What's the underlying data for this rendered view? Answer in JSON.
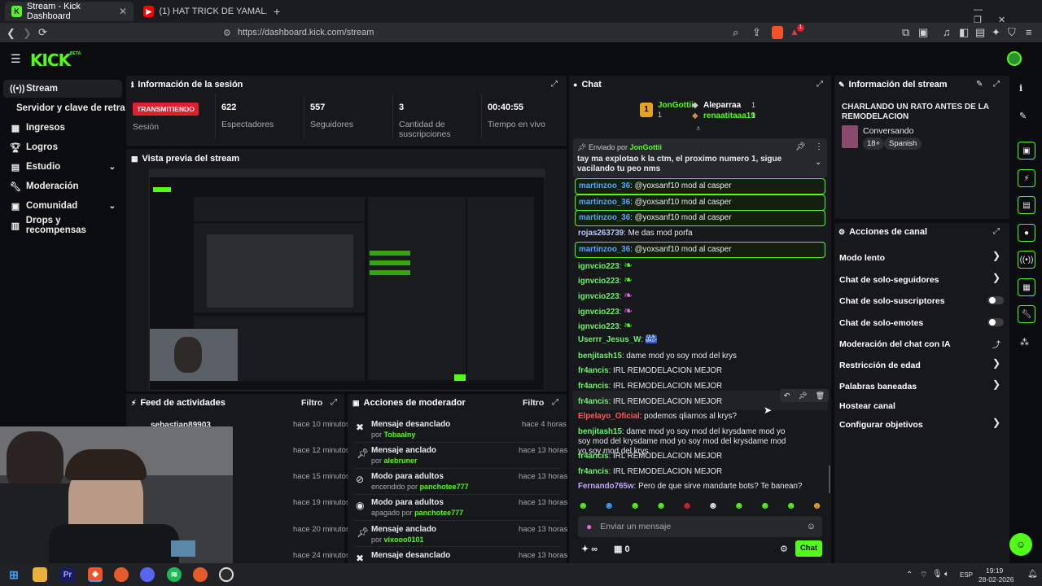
{
  "browser": {
    "tabs": [
      {
        "label": "Stream - Kick Dashboard",
        "icon": "kick-icon"
      },
      {
        "label": "(1) HAT TRICK DE YAMAL, GOLEADA",
        "icon": "youtube-icon"
      }
    ],
    "url": "https://dashboard.kick.com/stream",
    "new_tab": "+",
    "brave_badge": "1"
  },
  "header": {
    "logo": "KICK",
    "beta": "BETA"
  },
  "sidebar": {
    "items": [
      {
        "label": "Stream",
        "icon": "stream-icon"
      },
      {
        "label": "Servidor y clave de retransmisión"
      },
      {
        "label": "Ingresos",
        "icon": "income-icon"
      },
      {
        "label": "Logros",
        "icon": "trophy-icon"
      },
      {
        "label": "Estudio",
        "icon": "studio-icon"
      },
      {
        "label": "Moderación",
        "icon": "wrench-icon"
      },
      {
        "label": "Comunidad",
        "icon": "community-icon"
      },
      {
        "label": "Drops y recompensas",
        "icon": "drops-icon"
      }
    ]
  },
  "session": {
    "title": "Información de la sesión",
    "status": "TRANSMITIENDO",
    "status_label": "Sesión",
    "stats": [
      {
        "value": "622",
        "label": "Espectadores"
      },
      {
        "value": "557",
        "label": "Seguidores"
      },
      {
        "value": "3",
        "label": "Cantidad de suscripciones"
      },
      {
        "value": "00:40:55",
        "label": "Tiempo en vivo"
      }
    ]
  },
  "preview": {
    "title": "Vista previa del stream"
  },
  "activity": {
    "title": "Feed de actividades",
    "filter": "Filtro",
    "rows": [
      {
        "user": "sebastian89903",
        "time": "hace 10 minutos"
      },
      {
        "user": "",
        "time": "hace 12 minutos"
      },
      {
        "user": "",
        "time": "hace 15 minutos"
      },
      {
        "user": "",
        "time": "hace 19 minutos"
      },
      {
        "user": "",
        "time": "hace 20 minutos"
      },
      {
        "user": "",
        "time": "hace 24 minutos"
      }
    ]
  },
  "modactions": {
    "title": "Acciones de moderador",
    "filter": "Filtro",
    "rows": [
      {
        "action": "Mensaje desanclado",
        "prefix": "por",
        "user": "Tobaalny",
        "time": "hace 4 horas",
        "icon": "unpin-icon"
      },
      {
        "action": "Mensaje anclado",
        "prefix": "por",
        "user": "alebruner",
        "time": "hace 13 horas",
        "icon": "pin-icon"
      },
      {
        "action": "Modo para adultos",
        "prefix": "encendido por",
        "user": "panchotee777",
        "time": "hace 13 horas",
        "icon": "eye-off-icon"
      },
      {
        "action": "Modo para adultos",
        "prefix": "apagado por",
        "user": "panchotee777",
        "time": "hace 13 horas",
        "icon": "eye-icon"
      },
      {
        "action": "Mensaje anclado",
        "prefix": "por",
        "user": "vixooo0101",
        "time": "hace 13 horas",
        "icon": "pin-icon"
      },
      {
        "action": "Mensaje desanclado",
        "prefix": "",
        "user": "",
        "time": "hace 13 horas",
        "icon": "unpin-icon"
      }
    ]
  },
  "chat": {
    "title": "Chat",
    "top_gifters": [
      {
        "rank": "1",
        "name": "JonGottii",
        "count": "1"
      },
      {
        "rank": "",
        "name": "Aleparraa",
        "count": "1"
      },
      {
        "rank": "",
        "name": "renaatitaaa19",
        "count": "1"
      }
    ],
    "pinned": {
      "label": "Enviado por",
      "user": "JonGottii",
      "text": "tay ma explotao k la ctm, el proximo numero 1, sigue vacilando tu peo nms"
    },
    "messages": [
      {
        "user": "martinzoo_36",
        "text": "@yoxsanf10 mod al casper",
        "color": "#55a4ff",
        "highlight": true
      },
      {
        "user": "martinzoo_36",
        "text": "@yoxsanf10 mod al casper",
        "color": "#55a4ff",
        "highlight": true
      },
      {
        "user": "martinzoo_36",
        "text": "@yoxsanf10 mod al casper",
        "color": "#55a4ff",
        "highlight": true
      },
      {
        "user": "rojas263739",
        "text": "Me das mod porfa",
        "color": "#b9c9ff",
        "highlight": false
      },
      {
        "user": "martinzoo_36",
        "text": "@yoxsanf10 mod al casper",
        "color": "#55a4ff",
        "highlight": true
      },
      {
        "user": "ignvcio223",
        "text": "",
        "color": "#6ef06e",
        "highlight": false
      },
      {
        "user": "ignvcio223",
        "text": "",
        "color": "#6ef06e",
        "highlight": false
      },
      {
        "user": "ignvcio223",
        "text": "",
        "color": "#6ef06e",
        "highlight": false
      },
      {
        "user": "ignvcio223",
        "text": "",
        "color": "#6ef06e",
        "highlight": false
      },
      {
        "user": "ignvcio223",
        "text": "",
        "color": "#6ef06e",
        "highlight": false
      },
      {
        "user": "Userrr_Jesus_W",
        "text": "",
        "color": "#6ef06e",
        "highlight": false
      },
      {
        "user": "benjitash15",
        "text": "dame mod yo soy mod del krys",
        "color": "#6ef06e",
        "highlight": false
      },
      {
        "user": "fr4ancis",
        "text": "IRL REMODELACION MEJOR",
        "color": "#6ef06e",
        "highlight": false
      },
      {
        "user": "fr4ancis",
        "text": "IRL REMODELACION MEJOR",
        "color": "#6ef06e",
        "highlight": false
      },
      {
        "user": "fr4ancis",
        "text": "IRL REMODELACION MEJOR",
        "color": "#6ef06e",
        "highlight": false
      },
      {
        "user": "Elpelayo_Oficial",
        "text": "podemos qliarnos al krys?",
        "color": "#ff5a5a",
        "highlight": false
      },
      {
        "user": "benjitash15",
        "text": "dame mod yo soy mod del krysdame mod yo soy mod del krysdame mod yo soy mod del krysdame mod yo soy mod del krys",
        "color": "#6ef06e",
        "highlight": false
      },
      {
        "user": "fr4ancis",
        "text": "IRL REMODELACION MEJOR",
        "color": "#6ef06e",
        "highlight": false
      },
      {
        "user": "fr4ancis",
        "text": "IRL REMODELACION MEJOR",
        "color": "#6ef06e",
        "highlight": false
      },
      {
        "user": "Fernando765w",
        "text": "Pero de que sirve mandarte bots? Te banean?",
        "color": "#c4a6ff",
        "highlight": false
      }
    ],
    "emote_jesus": "QUE MAS?",
    "input_placeholder": "Enviar un mensaje",
    "points": "∞",
    "gift_count": "0",
    "send_label": "Chat"
  },
  "stream_info": {
    "title": "Información del stream",
    "stream_title": "CHARLANDO UN RATO ANTES DE LA REMODELACION",
    "category": "Conversando",
    "tags": [
      "18+",
      "Spanish"
    ]
  },
  "channel_actions": {
    "title": "Acciones de canal",
    "items": [
      {
        "label": "Modo lento",
        "control": "chevron"
      },
      {
        "label": "Chat de solo-seguidores",
        "control": "chevron"
      },
      {
        "label": "Chat de solo-suscriptores",
        "control": "toggle"
      },
      {
        "label": "Chat de solo-emotes",
        "control": "toggle"
      },
      {
        "label": "Moderación del chat con IA",
        "control": "external"
      },
      {
        "label": "Restricción de edad",
        "control": "chevron"
      },
      {
        "label": "Palabras baneadas",
        "control": "chevron"
      },
      {
        "label": "Hostear canal",
        "control": "none"
      },
      {
        "label": "Configurar objetivos",
        "control": "chevron"
      }
    ]
  },
  "taskbar": {
    "apps": [
      "windows",
      "explorer",
      "premiere",
      "brave",
      "firefox",
      "discord",
      "spotify",
      "firefox",
      "obs"
    ],
    "lang": "ESP",
    "time": "19:19",
    "date": "28-02-2026"
  },
  "colors": {
    "accent": "#53fc18",
    "live": "#e0202c",
    "panel": "#17181b",
    "bg": "#0b0c0e"
  }
}
